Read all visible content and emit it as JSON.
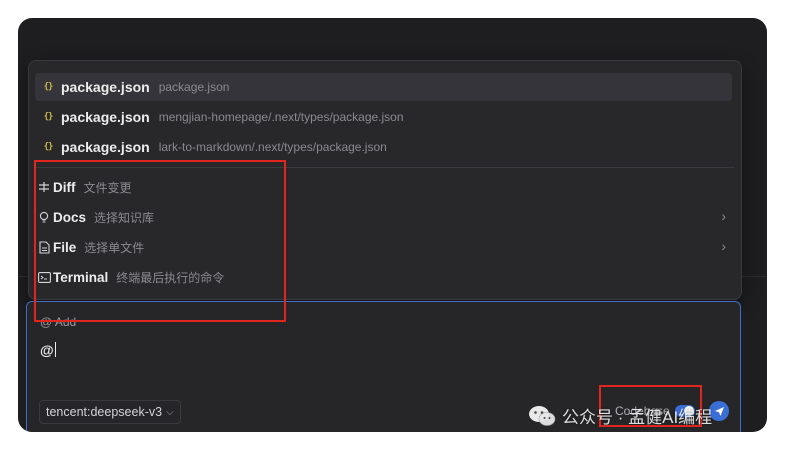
{
  "files": [
    {
      "name": "package.json",
      "path": "package.json",
      "selected": true
    },
    {
      "name": "package.json",
      "path": "mengjian-homepage/.next/types/package.json",
      "selected": false
    },
    {
      "name": "package.json",
      "path": "lark-to-markdown/.next/types/package.json",
      "selected": false
    }
  ],
  "file_icon_glyph": "{}",
  "menu": [
    {
      "label": "Diff",
      "desc": "文件变更",
      "icon": "diff-icon",
      "chevron": ""
    },
    {
      "label": "Docs",
      "desc": "选择知识库",
      "icon": "lightbulb-icon",
      "chevron": "›"
    },
    {
      "label": "File",
      "desc": "选择单文件",
      "icon": "document-icon",
      "chevron": "›"
    },
    {
      "label": "Terminal",
      "desc": "终端最后执行的命令",
      "icon": "terminal-icon",
      "chevron": ""
    }
  ],
  "input": {
    "add_label": "@ Add",
    "value": "@"
  },
  "footer": {
    "model": "tencent:deepseek-v3",
    "model_dropdown_glyph": "⌵",
    "codebase_label": "Codebase",
    "codebase_enabled": true
  },
  "watermark": {
    "text": "公众号 · 孟健AI编程"
  },
  "colors": {
    "accent": "#3b6fd8",
    "annotation": "#e0261e",
    "json_icon": "#c7b74a"
  }
}
